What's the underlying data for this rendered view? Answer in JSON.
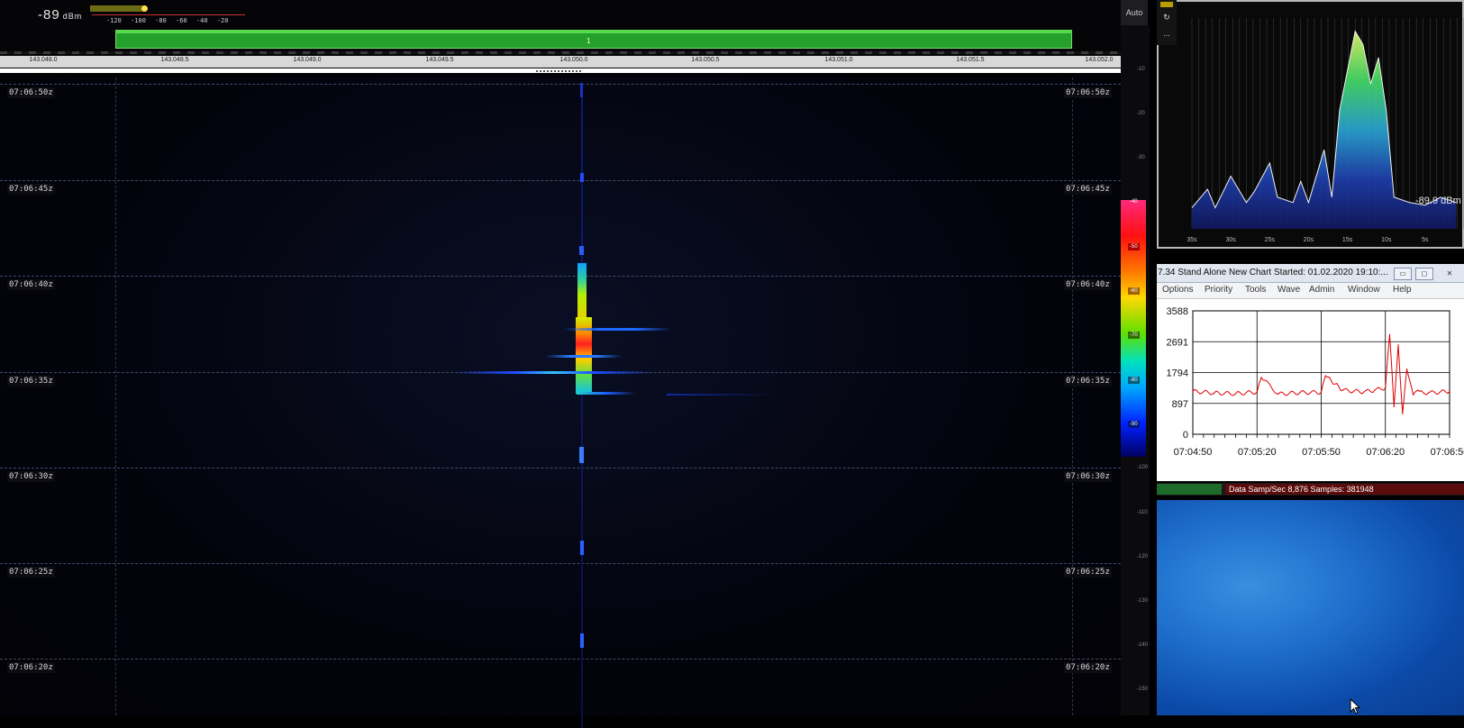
{
  "sdr": {
    "signal_level": "-89",
    "signal_unit": "dBm",
    "s_scale": [
      "-120",
      "-100",
      "-80",
      "-60",
      "-40",
      "-20"
    ],
    "band_label": "1",
    "auto_button": "Auto",
    "freq_labels": [
      "143.048.0",
      "143.048.5",
      "143.049.0",
      "143.049.5",
      "143.050.0",
      "143.050.5",
      "143.051.0",
      "143.051.5",
      "143.052.0"
    ],
    "time_labels": [
      "07:06:50z",
      "07:06:45z",
      "07:06:40z",
      "07:06:35z",
      "07:06:30z",
      "07:06:25z",
      "07:06:20z"
    ],
    "db_scale": [
      "-10",
      "-20",
      "-30",
      "-40",
      "-50",
      "-60",
      "-70",
      "-80",
      "-90",
      "-100",
      "-110",
      "-120",
      "-130",
      "-140",
      "-150"
    ],
    "colors": {
      "waterfall_bg": "#020207",
      "band_fill": "#25a02a",
      "signal_hot": "#ff3030"
    }
  },
  "spectrum_window": {
    "readout": "-89.9 dBm",
    "x_ticks": [
      "35s",
      "30s",
      "25s",
      "20s",
      "15s",
      "10s",
      "5s"
    ]
  },
  "chart_window": {
    "title": "7.34  Stand Alone  New Chart Started: 01.02.2020 19:10:...",
    "menu": [
      "Options",
      "Priority",
      "Tools",
      "Wave",
      "Admin",
      "Window",
      "Help"
    ],
    "status": "Data Samp/Sec 8,876   Samples:  381948"
  },
  "chart_data": [
    {
      "type": "line",
      "title": "",
      "xlabel": "",
      "ylabel": "",
      "x_ticks": [
        "07:04:50",
        "07:05:20",
        "07:05:50",
        "07:06:20",
        "07:06:50"
      ],
      "y_ticks": [
        "0",
        "897",
        "1794",
        "2691",
        "3588"
      ],
      "ylim": [
        0,
        3588
      ],
      "grid": true,
      "series": [
        {
          "color": "#e00000",
          "x": [
            "07:04:50",
            "07:05:00",
            "07:05:10",
            "07:05:20",
            "07:05:22",
            "07:05:30",
            "07:05:40",
            "07:05:50",
            "07:05:52",
            "07:06:00",
            "07:06:10",
            "07:06:15",
            "07:06:20",
            "07:06:22",
            "07:06:24",
            "07:06:26",
            "07:06:28",
            "07:06:30",
            "07:06:33",
            "07:06:36",
            "07:06:40",
            "07:06:50"
          ],
          "values": [
            1250,
            1200,
            1180,
            1230,
            1650,
            1170,
            1210,
            1220,
            1700,
            1280,
            1230,
            1280,
            1350,
            2900,
            800,
            2600,
            600,
            1900,
            1150,
            1250,
            1200,
            1250
          ]
        }
      ]
    },
    {
      "type": "area",
      "title": "",
      "xlabel": "",
      "ylabel": "",
      "x_ticks": [
        "35s",
        "30s",
        "25s",
        "20s",
        "15s",
        "10s",
        "5s"
      ],
      "series": [
        {
          "color": "#3fc0ff",
          "x": [
            35,
            33,
            32,
            30,
            28,
            27,
            25,
            24,
            22,
            21,
            20,
            18,
            17,
            16,
            15,
            14,
            13,
            12,
            11,
            10,
            9,
            7,
            5,
            3,
            1
          ],
          "values": [
            -92,
            -85,
            -92,
            -80,
            -90,
            -86,
            -75,
            -88,
            -90,
            -82,
            -90,
            -70,
            -88,
            -55,
            -40,
            -25,
            -30,
            -45,
            -35,
            -55,
            -88,
            -90,
            -91,
            -88,
            -90
          ]
        }
      ]
    }
  ]
}
